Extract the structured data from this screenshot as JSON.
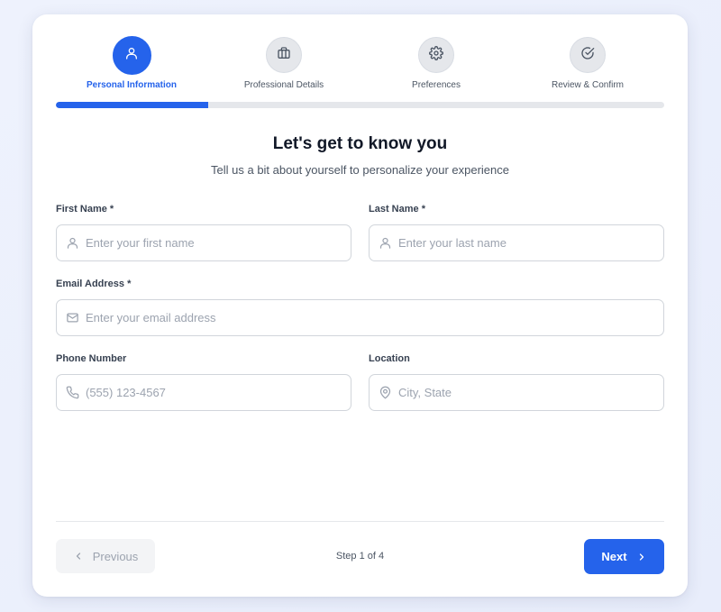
{
  "stepper": {
    "steps": [
      {
        "label": "Personal Information",
        "icon": "user-icon",
        "active": true
      },
      {
        "label": "Professional Details",
        "icon": "briefcase-icon",
        "active": false
      },
      {
        "label": "Preferences",
        "icon": "gear-icon",
        "active": false
      },
      {
        "label": "Review & Confirm",
        "icon": "check-circle-icon",
        "active": false
      }
    ],
    "progress_fraction": 0.25
  },
  "heading": {
    "title": "Let's get to know you",
    "subtitle": "Tell us a bit about yourself to personalize your experience"
  },
  "form": {
    "first_name": {
      "label": "First Name *",
      "placeholder": "Enter your first name",
      "value": "",
      "icon": "user-icon"
    },
    "last_name": {
      "label": "Last Name *",
      "placeholder": "Enter your last name",
      "value": "",
      "icon": "user-icon"
    },
    "email": {
      "label": "Email Address *",
      "placeholder": "Enter your email address",
      "value": "",
      "icon": "mail-icon"
    },
    "phone": {
      "label": "Phone Number",
      "placeholder": "(555) 123-4567",
      "value": "",
      "icon": "phone-icon"
    },
    "location": {
      "label": "Location",
      "placeholder": "City, State",
      "value": "",
      "icon": "map-pin-icon"
    }
  },
  "footer": {
    "previous_label": "Previous",
    "next_label": "Next",
    "step_counter": "Step 1 of 4"
  },
  "colors": {
    "accent": "#2563eb",
    "inactive_step": "#e5e7eb",
    "track": "#e5e7eb"
  }
}
